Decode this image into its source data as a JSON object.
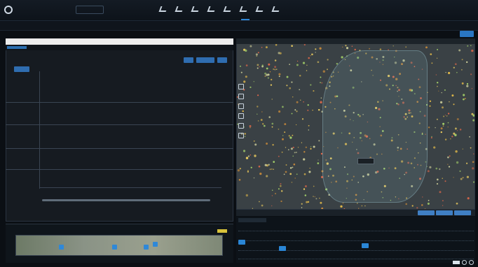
{
  "header": {
    "logo_text": "",
    "subtitle": "",
    "nav": [
      {
        "label": ""
      },
      {
        "label": ""
      },
      {
        "label": ""
      },
      {
        "label": ""
      },
      {
        "label": ""
      },
      {
        "label": ""
      },
      {
        "label": ""
      },
      {
        "label": ""
      }
    ],
    "info_line1": "",
    "info_line2": ""
  },
  "subbar": {
    "text": ""
  },
  "filters": {
    "text": ""
  },
  "left_panel": {
    "title": "",
    "controls": [
      {
        "label": ""
      },
      {
        "label": ""
      },
      {
        "label": ""
      }
    ],
    "lanes": [
      {
        "label": "",
        "color": "#e05a4a"
      },
      {
        "label": "",
        "color": "#a06ae0"
      },
      {
        "label": "",
        "color": "#e0a040"
      },
      {
        "label": "",
        "color": "#4ad07a"
      }
    ],
    "events": [
      {
        "text": "",
        "color": "#e0504a"
      },
      {
        "text": "",
        "color": "#e0504a"
      },
      {
        "text": "",
        "color": "#a06ae0"
      },
      {
        "text": "",
        "color": "#a06ae0"
      },
      {
        "text": "",
        "color": "#e0a040"
      },
      {
        "text": "",
        "color": "#e0a040"
      },
      {
        "text": "",
        "color": "#4ad07a"
      },
      {
        "text": "",
        "color": "#d9d9d9"
      }
    ]
  },
  "map": {
    "title": "",
    "tooltip": "",
    "status_text": "",
    "buttons": [
      {
        "label": ""
      },
      {
        "label": ""
      },
      {
        "label": ""
      }
    ]
  },
  "timeline": {
    "title": ""
  },
  "colors": {
    "accent": "#2f86d6",
    "panel": "#161b21",
    "map": "#3a4145"
  }
}
